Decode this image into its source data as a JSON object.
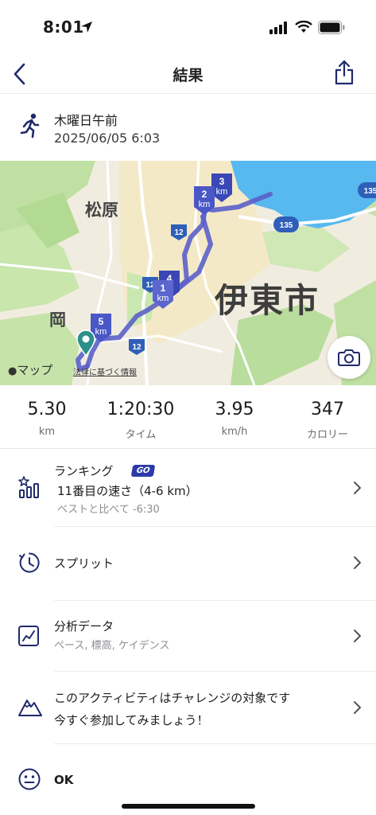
{
  "status_bar": {
    "time": "8:01"
  },
  "nav": {
    "title": "結果",
    "back_icon": "chevron-left-icon",
    "share_icon": "share-icon"
  },
  "activity": {
    "type_icon": "running-icon",
    "title": "木曜日午前",
    "datetime": "2025/06/05 6:03"
  },
  "map": {
    "labels": {
      "matsubara": "松原",
      "ito_city": "伊東市",
      "oka": "岡"
    },
    "road_labels": [
      "12",
      "12",
      "12",
      "135",
      "135"
    ],
    "km_markers": [
      "1",
      "2",
      "3",
      "4",
      "5"
    ],
    "km_unit": "km",
    "attribution": "マップ",
    "legal": "法律に基づく情報",
    "route_color": "#5b61c9",
    "water_color": "#58b8f0"
  },
  "stats": [
    {
      "value": "5.30",
      "label": "km"
    },
    {
      "value": "1:20:30",
      "label": "タイム"
    },
    {
      "value": "3.95",
      "label": "km/h"
    },
    {
      "value": "347",
      "label": "カロリー"
    }
  ],
  "ranking": {
    "title": "ランキング",
    "badge": "GO",
    "line1": "11番目の速さ（4-6 km）",
    "line2": "ベストと比べて -6:30"
  },
  "splits": {
    "title": "スプリット"
  },
  "analysis": {
    "title": "分析データ",
    "subtitle": "ペース, 標高, ケイデンス"
  },
  "challenge": {
    "title": "このアクティビティはチャレンジの対象です",
    "subtitle": "今すぐ参加してみましょう！"
  },
  "mood": {
    "title": "OK"
  },
  "colors": {
    "accent": "#2b3aa8",
    "icon_navy": "#1f2a6b"
  }
}
